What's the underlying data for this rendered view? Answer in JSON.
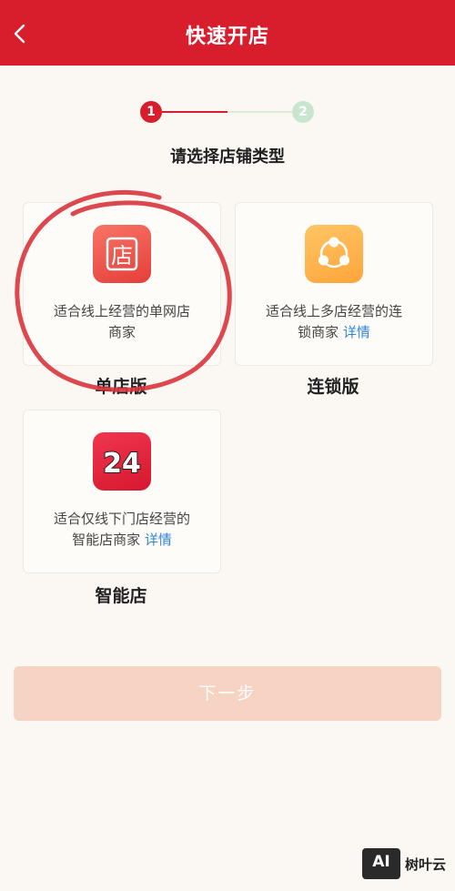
{
  "header": {
    "title": "快速开店"
  },
  "steps": [
    {
      "number": "1",
      "active": true
    },
    {
      "number": "2",
      "active": false
    }
  ],
  "subtitle": "请选择店铺类型",
  "cards": [
    {
      "icon": "store-icon",
      "icon_text": "店",
      "desc_line1": "适合线上经营的单网店",
      "desc_line2": "商家",
      "link": "",
      "label": "单店版"
    },
    {
      "icon": "chain-icon",
      "icon_text": "",
      "desc_line1": "适合线上多店经营的连",
      "desc_line2": "锁商家",
      "link": "详情",
      "label": "连锁版"
    },
    {
      "icon": "24-hour-icon",
      "icon_text": "24",
      "desc_line1": "适合仅线下门店经营的",
      "desc_line2": "智能店商家",
      "link": "详情",
      "label": "智能店"
    }
  ],
  "next_button": {
    "label": "下一步"
  },
  "watermark": {
    "logo": "AI",
    "text": "树叶云"
  },
  "colors": {
    "brand": "#d81e2d",
    "link": "#2f86d6",
    "button_disabled": "#f7d3c3"
  }
}
